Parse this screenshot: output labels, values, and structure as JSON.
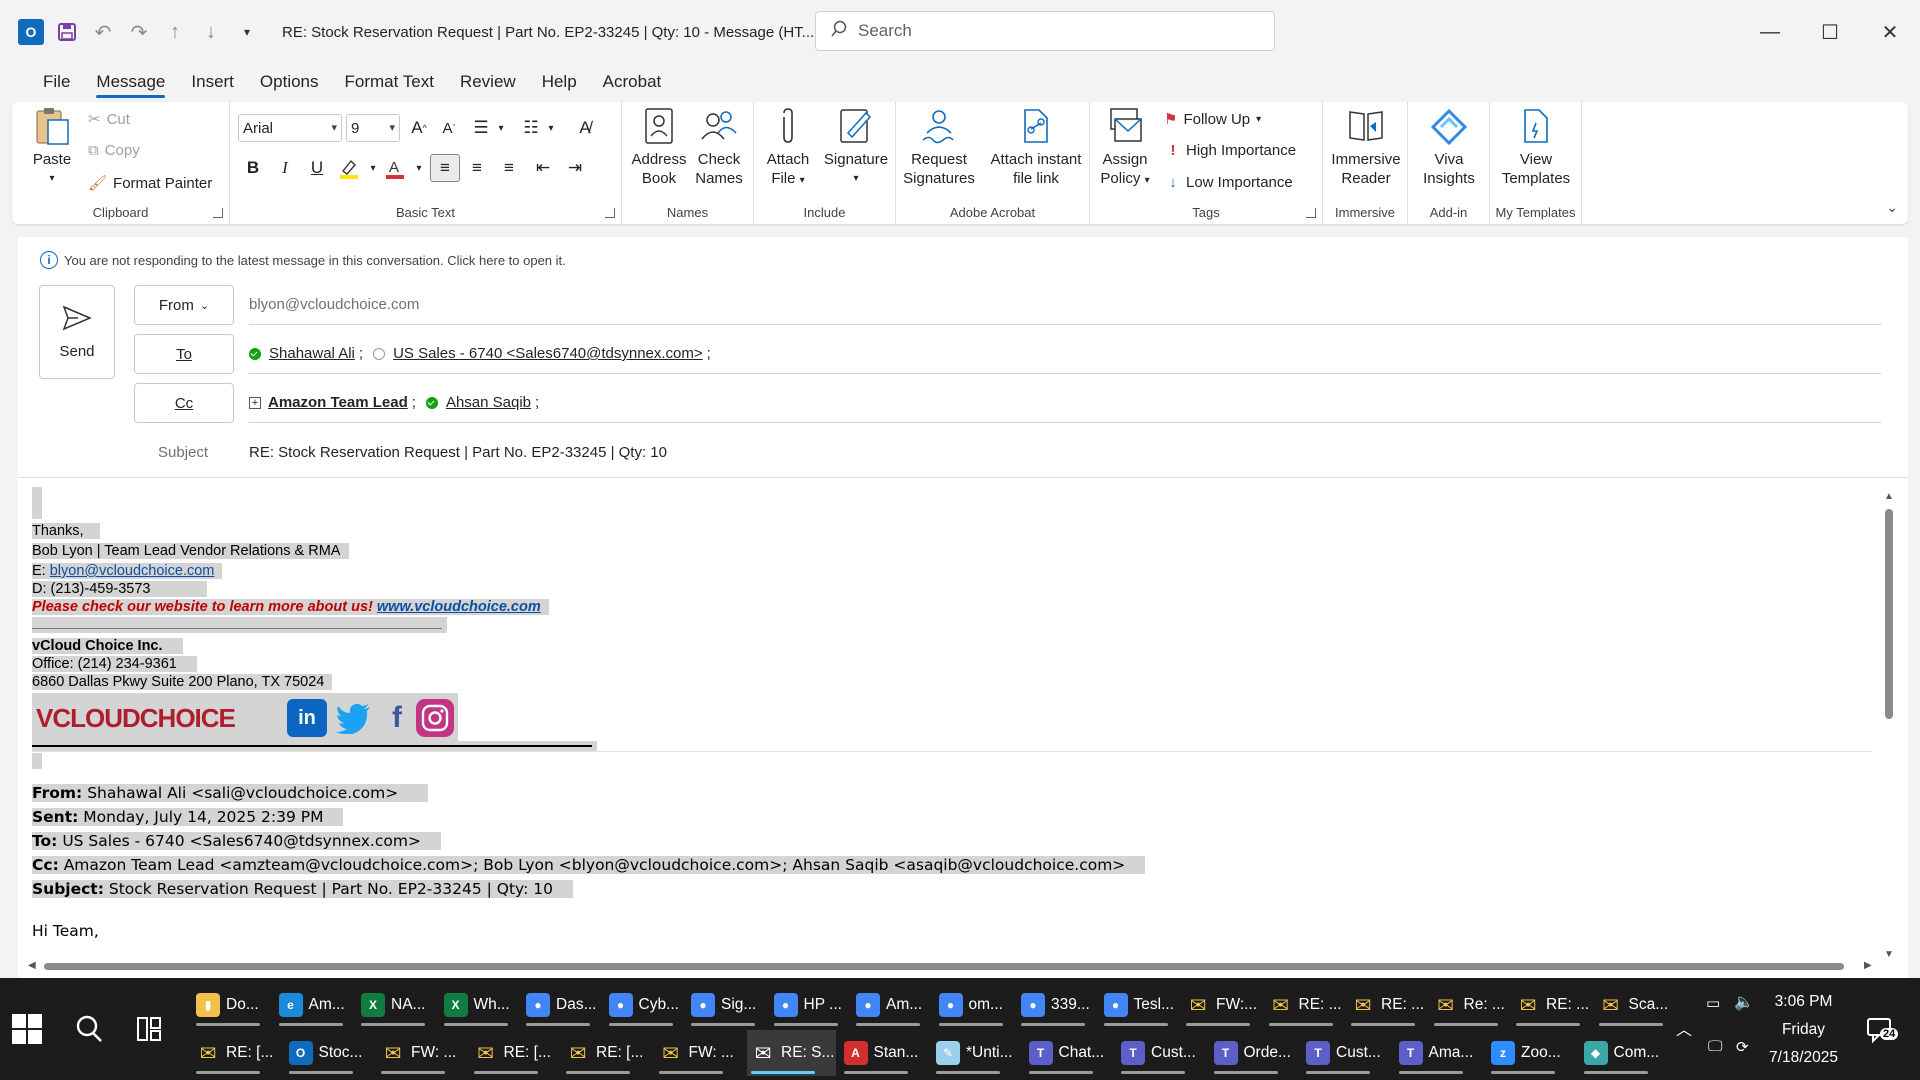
{
  "window": {
    "title": "RE: Stock Reservation Request | Part No. EP2-33245 | Qty: 10  -  Message (HT...",
    "search_placeholder": "Search"
  },
  "menu_tabs": [
    "File",
    "Message",
    "Insert",
    "Options",
    "Format Text",
    "Review",
    "Help",
    "Acrobat"
  ],
  "active_tab": "Message",
  "ribbon": {
    "clipboard": {
      "label": "Clipboard",
      "paste": "Paste",
      "cut": "Cut",
      "copy": "Copy",
      "format_painter": "Format Painter"
    },
    "basic_text": {
      "label": "Basic Text",
      "font": "Arial",
      "size": "9",
      "bold": "B",
      "italic": "I",
      "underline": "U"
    },
    "names": {
      "label": "Names",
      "address_book_1": "Address",
      "address_book_2": "Book",
      "check_names_1": "Check",
      "check_names_2": "Names"
    },
    "include": {
      "label": "Include",
      "attach_file_1": "Attach",
      "attach_file_2": "File",
      "signature": "Signature"
    },
    "adobe": {
      "label": "Adobe Acrobat",
      "request_sig_1": "Request",
      "request_sig_2": "Signatures",
      "attach_link_1": "Attach instant",
      "attach_link_2": "file link"
    },
    "tags": {
      "label": "Tags",
      "assign_policy_1": "Assign",
      "assign_policy_2": "Policy",
      "follow_up": "Follow Up",
      "high_importance": "High Importance",
      "low_importance": "Low Importance"
    },
    "immersive": {
      "label": "Immersive",
      "reader_1": "Immersive",
      "reader_2": "Reader"
    },
    "addin": {
      "label": "Add-in",
      "viva_1": "Viva",
      "viva_2": "Insights"
    },
    "templates": {
      "label": "My Templates",
      "view_1": "View",
      "view_2": "Templates"
    }
  },
  "compose": {
    "info_text": "You are not responding to the latest message in this conversation. Click here to open it.",
    "send_label": "Send",
    "from_label": "From",
    "from_value": "blyon@vcloudchoice.com",
    "to_label": "To",
    "to_recipients": [
      "Shahawal Ali",
      "US Sales - 6740 <Sales6740@tdsynnex.com>"
    ],
    "cc_label": "Cc",
    "cc_recipients": [
      "Amazon Team Lead",
      "Ahsan Saqib"
    ],
    "subject_label": "Subject",
    "subject_value": "RE: Stock Reservation Request | Part No. EP2-33245 | Qty: 10"
  },
  "body": {
    "thanks": "Thanks,",
    "sig_name": "Bob Lyon | Team Lead Vendor Relations & RMA",
    "sig_email_prefix": "E: ",
    "sig_email": "blyon@vcloudchoice.com",
    "sig_direct": "D: (213)-459-3573",
    "sig_promo": "Please check our website to learn more about us!",
    "sig_website": "www.vcloudchoice.com",
    "company": "vCloud Choice Inc.",
    "office": "Office: (214) 234-9361",
    "address": "6860 Dallas Pkwy Suite 200 Plano, TX 75024",
    "logo_text": "VCLOUDCHOICE",
    "quoted": {
      "from_label": "From:",
      "from": "Shahawal Ali <sali@vcloudchoice.com>",
      "sent_label": "Sent:",
      "sent": "Monday, July 14, 2025 2:39 PM",
      "to_label": "To:",
      "to": "US Sales - 6740 <Sales6740@tdsynnex.com>",
      "cc_label": "Cc:",
      "cc": "Amazon Team Lead <amzteam@vcloudchoice.com>; Bob Lyon <blyon@vcloudchoice.com>; Ahsan Saqib <asaqib@vcloudchoice.com>",
      "subject_label": "Subject:",
      "subject": "Stock Reservation Request | Part No. EP2-33245 | Qty: 10"
    },
    "greeting": "Hi Team,"
  },
  "taskbar": {
    "row1": [
      {
        "label": "Do...",
        "icon": "folder-icon",
        "color": "#f0c24b"
      },
      {
        "label": "Am...",
        "icon": "edge-icon",
        "color": "#1c8ad8"
      },
      {
        "label": "NA...",
        "icon": "excel-icon",
        "color": "#107c41"
      },
      {
        "label": "Wh...",
        "icon": "excel-icon",
        "color": "#107c41"
      },
      {
        "label": "Das...",
        "icon": "chrome-icon",
        "color": "#4285f4"
      },
      {
        "label": "Cyb...",
        "icon": "chrome-icon",
        "color": "#4285f4"
      },
      {
        "label": "Sig...",
        "icon": "chrome-icon",
        "color": "#4285f4"
      },
      {
        "label": "HP ...",
        "icon": "chrome-icon",
        "color": "#4285f4"
      },
      {
        "label": "Am...",
        "icon": "chrome-icon",
        "color": "#4285f4"
      },
      {
        "label": "om...",
        "icon": "chrome-icon",
        "color": "#4285f4"
      },
      {
        "label": "339...",
        "icon": "chrome-icon",
        "color": "#4285f4"
      },
      {
        "label": "Tesl...",
        "icon": "chrome-icon",
        "color": "#4285f4"
      },
      {
        "label": "FW:...",
        "icon": "mail-icon",
        "color": "#f0c24b"
      },
      {
        "label": "RE: ...",
        "icon": "mail-icon",
        "color": "#f0c24b"
      },
      {
        "label": "RE: ...",
        "icon": "mail-icon",
        "color": "#f0c24b"
      },
      {
        "label": "Re: ...",
        "icon": "mail-icon",
        "color": "#f0c24b"
      },
      {
        "label": "RE: ...",
        "icon": "mail-icon",
        "color": "#f0c24b"
      },
      {
        "label": "Sca...",
        "icon": "mail-icon",
        "color": "#f0c24b"
      }
    ],
    "row2": [
      {
        "label": "RE: [...",
        "icon": "mail-icon",
        "color": "#f0c24b"
      },
      {
        "label": "Stoc...",
        "icon": "outlook-icon",
        "color": "#0f6cbd"
      },
      {
        "label": "FW: ...",
        "icon": "mail-icon",
        "color": "#f0c24b"
      },
      {
        "label": "RE: [...",
        "icon": "mail-icon",
        "color": "#f0c24b"
      },
      {
        "label": "RE: [...",
        "icon": "mail-icon",
        "color": "#f0c24b"
      },
      {
        "label": "FW: ...",
        "icon": "mail-icon",
        "color": "#f0c24b"
      },
      {
        "label": "RE: S...",
        "icon": "mail-icon",
        "color": "#ffffff"
      },
      {
        "label": "Stan...",
        "icon": "pdf-icon",
        "color": "#d32f2f"
      },
      {
        "label": "*Unti...",
        "icon": "notepad-icon",
        "color": "#9ad0ec"
      },
      {
        "label": "Chat...",
        "icon": "teams-icon",
        "color": "#5b5fc7"
      },
      {
        "label": "Cust...",
        "icon": "teams-icon",
        "color": "#5b5fc7"
      },
      {
        "label": "Orde...",
        "icon": "teams-icon",
        "color": "#5b5fc7"
      },
      {
        "label": "Cust...",
        "icon": "teams-icon",
        "color": "#5b5fc7"
      },
      {
        "label": "Ama...",
        "icon": "teams-icon",
        "color": "#5b5fc7"
      },
      {
        "label": "Zoo...",
        "icon": "zoom-icon",
        "color": "#2d8cff"
      },
      {
        "label": "Com...",
        "icon": "app-icon",
        "color": "#3aa6a6"
      }
    ],
    "clock_time": "3:06 PM",
    "clock_day": "Friday",
    "clock_date": "7/18/2025",
    "notification_count": "24"
  }
}
